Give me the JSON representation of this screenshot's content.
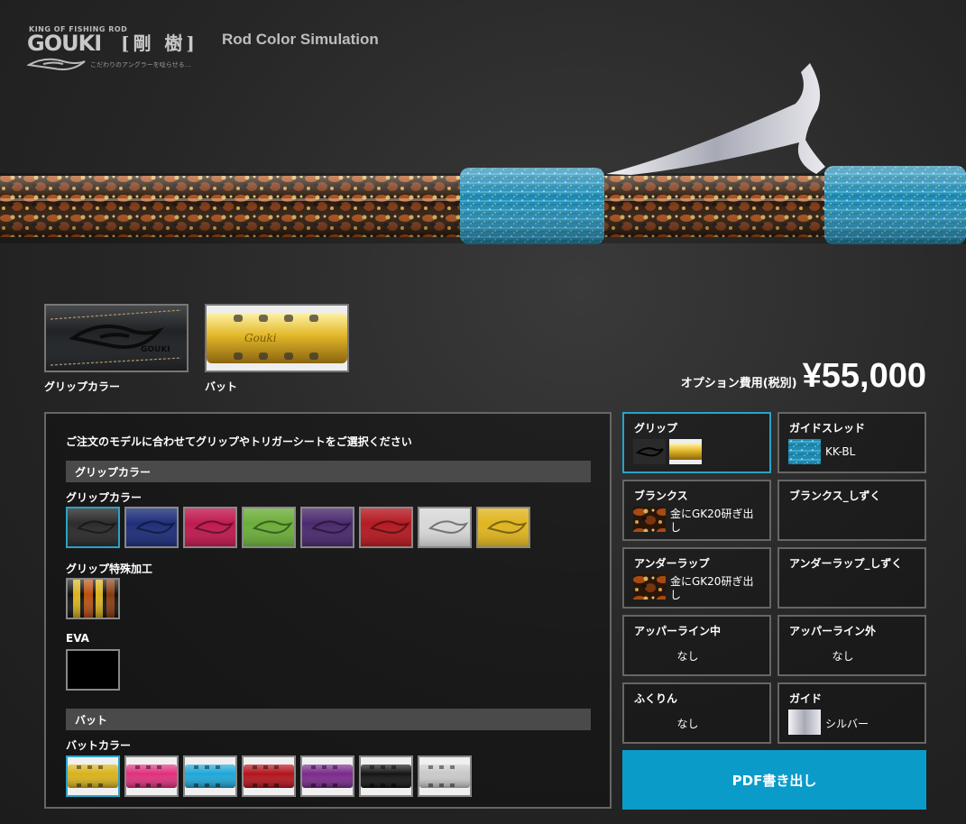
{
  "logo": {
    "small_text": "KING OF FISHING ROD",
    "brand": "GOUKI",
    "kanji": "[剛 樹]",
    "tagline": "こだわりのアングラーを唸らせる…"
  },
  "app_title": "Rod Color Simulation",
  "preview": {
    "thumbnails": [
      {
        "label": "グリップカラー"
      },
      {
        "label": "バット"
      }
    ]
  },
  "price": {
    "label": "オプション費用(税別)",
    "value": "¥55,000"
  },
  "panel": {
    "instruction": "ご注文のモデルに合わせてグリップやトリガーシートをご選択ください",
    "grip_section": {
      "header": "グリップカラー",
      "color_label": "グリップカラー",
      "colors": [
        "#2c2c2c",
        "#1e2f7a",
        "#c01a4f",
        "#6cae3a",
        "#4b2a6e",
        "#b51a22",
        "#d8d8d8",
        "#e0b520"
      ],
      "special_label": "グリップ特殊加工",
      "eva_label": "EVA"
    },
    "butt_section": {
      "header": "バット",
      "color_label": "バットカラー",
      "colors": [
        "#d9b21c",
        "#e0307d",
        "#1ea7d8",
        "#b4141c",
        "#7a2a8c",
        "#151515",
        "#c9c9c9"
      ]
    }
  },
  "options": [
    {
      "title": "グリップ",
      "value": ""
    },
    {
      "title": "ガイドスレッド",
      "value": "KK-BL"
    },
    {
      "title": "ブランクス",
      "value": "金にGK20研ぎ出し"
    },
    {
      "title": "ブランクス_しずく",
      "value": ""
    },
    {
      "title": "アンダーラップ",
      "value": "金にGK20研ぎ出し"
    },
    {
      "title": "アンダーラップ_しずく",
      "value": ""
    },
    {
      "title": "アッパーライン中",
      "value": "なし"
    },
    {
      "title": "アッパーライン外",
      "value": "なし"
    },
    {
      "title": "ふくりん",
      "value": "なし"
    },
    {
      "title": "ガイド",
      "value": "シルバー"
    }
  ],
  "pdf_button": "PDF書き出し",
  "colors": {
    "accent": "#0b9bc9",
    "selected_border": "#29a3c8"
  }
}
